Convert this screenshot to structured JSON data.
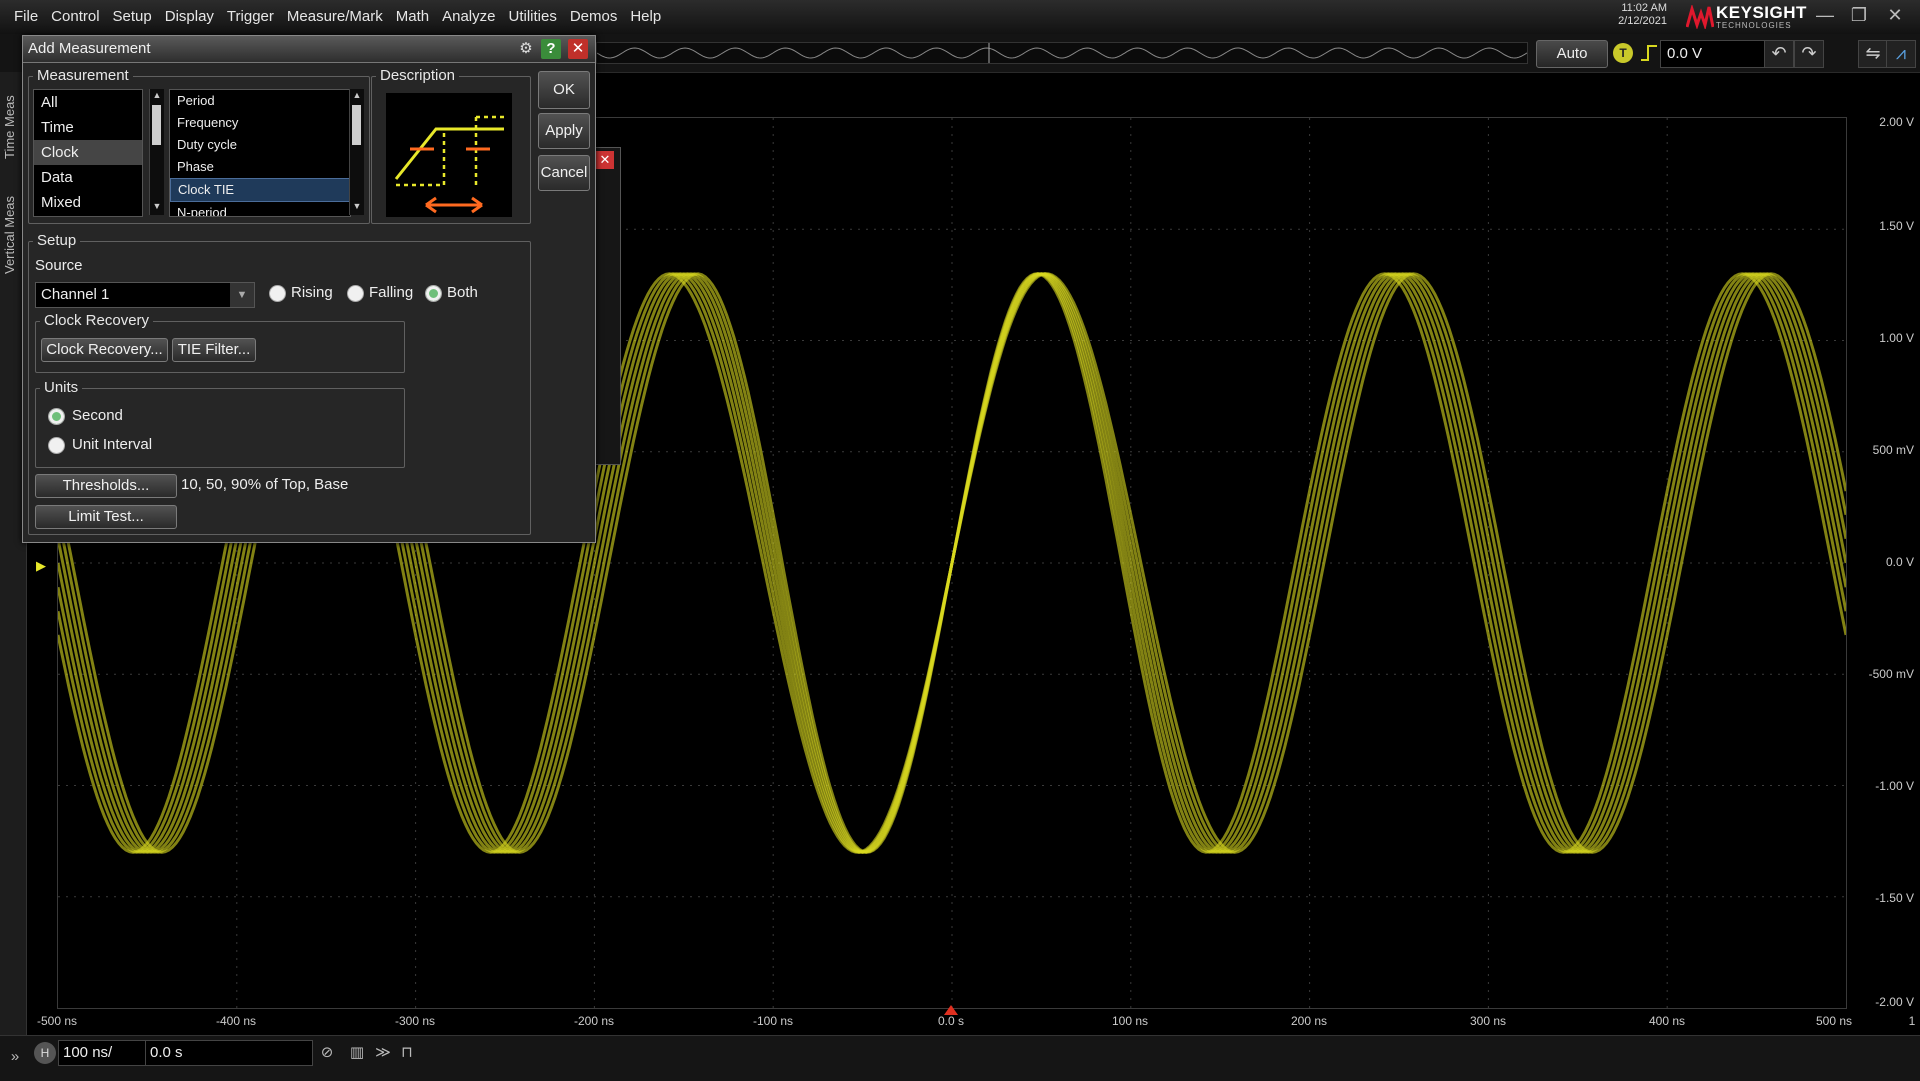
{
  "menubar": {
    "items": [
      "File",
      "Control",
      "Setup",
      "Display",
      "Trigger",
      "Measure/Mark",
      "Math",
      "Analyze",
      "Utilities",
      "Demos",
      "Help"
    ],
    "time": "11:02 AM",
    "date": "2/12/2021",
    "brand_name": "KEYSIGHT",
    "brand_sub": "TECHNOLOGIES"
  },
  "toolbar": {
    "trigger_mode": "Auto",
    "trigger_icon": "T",
    "trigger_level": "0.0 V"
  },
  "leftstrip": {
    "tab1": "Time Meas",
    "tab2": "Vertical Meas"
  },
  "dialog": {
    "title": "Add Measurement",
    "measurement_label": "Measurement",
    "categories": [
      "All",
      "Time",
      "Clock",
      "Data",
      "Mixed"
    ],
    "selected_category": "Clock",
    "measurements": [
      "Period",
      "Frequency",
      "Duty cycle",
      "Phase",
      "Clock TIE",
      "N-period"
    ],
    "selected_measurement": "Clock TIE",
    "description_label": "Description",
    "ok_label": "OK",
    "apply_label": "Apply",
    "cancel_label": "Cancel",
    "setup_label": "Setup",
    "source_label": "Source",
    "source_value": "Channel 1",
    "edge_options": [
      "Rising",
      "Falling",
      "Both"
    ],
    "edge_selected": "Both",
    "clock_recovery_label": "Clock Recovery",
    "clock_recovery_button": "Clock Recovery...",
    "tie_filter_button": "TIE Filter...",
    "units_label": "Units",
    "units_options": [
      "Second",
      "Unit Interval"
    ],
    "units_selected": "Second",
    "thresholds_button": "Thresholds...",
    "thresholds_text": "10, 50, 90% of Top, Base",
    "limit_test_button": "Limit Test..."
  },
  "axes": {
    "y_labels": [
      "2.00 V",
      "1.50 V",
      "1.00 V",
      "500 mV",
      "0.0 V",
      "-500 mV",
      "-1.00 V",
      "-1.50 V",
      "-2.00 V"
    ],
    "x_labels": [
      "-500 ns",
      "-400 ns",
      "-300 ns",
      "-200 ns",
      "-100 ns",
      "0.0 s",
      "100 ns",
      "200 ns",
      "300 ns",
      "400 ns",
      "500 ns"
    ],
    "x_end_label": "1"
  },
  "bottombar": {
    "h_label": "H",
    "timebase": "100 ns/",
    "delay": "0.0 s"
  },
  "waveform": {
    "color": "#d8d820",
    "period_ns": 200,
    "amplitude_v": 1.3,
    "jitter_ns": 8
  }
}
